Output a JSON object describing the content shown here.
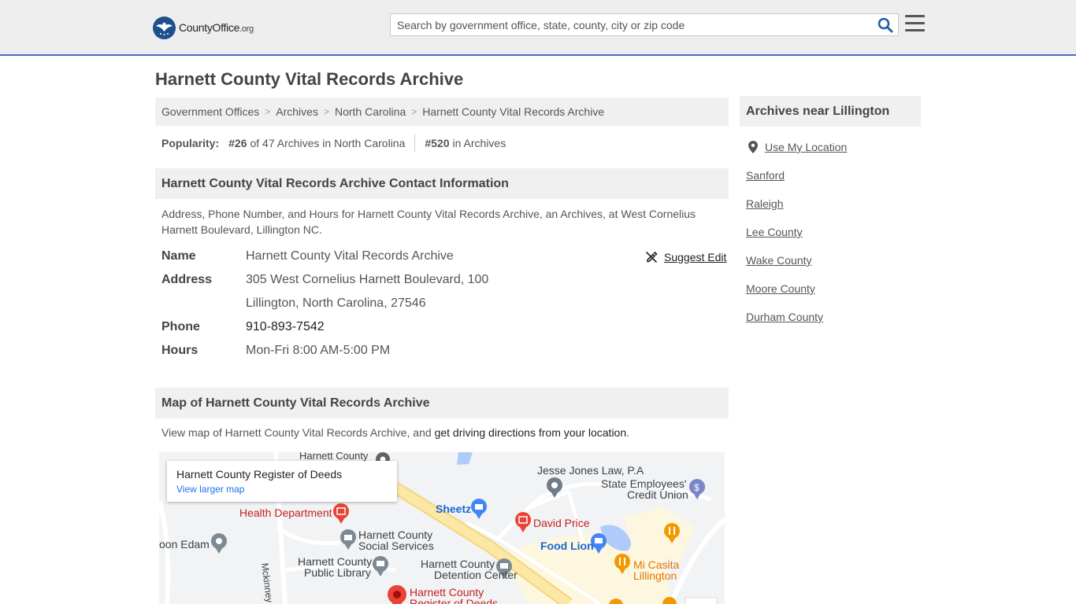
{
  "header": {
    "logo_text_main": "CountyOffice",
    "logo_text_org": ".org",
    "search_placeholder": "Search by government office, state, county, city or zip code",
    "search_icon": "search-icon",
    "menu_icon": "hamburger-menu-icon",
    "accent_color": "#3f74b8"
  },
  "page": {
    "title": "Harnett County Vital Records Archive"
  },
  "breadcrumb": [
    "Government Offices",
    "Archives",
    "North Carolina",
    "Harnett County Vital Records Archive"
  ],
  "popularity": {
    "label": "Popularity:",
    "state_rank": "#26",
    "state_text": "of 47 Archives in North Carolina",
    "national_rank": "#520",
    "national_text": "in Archives"
  },
  "contact": {
    "heading": "Harnett County Vital Records Archive Contact Information",
    "description": "Address, Phone Number, and Hours for Harnett County Vital Records Archive, an Archives, at West Cornelius Harnett Boulevard, Lillington NC.",
    "suggest_edit": "Suggest Edit",
    "name_label": "Name",
    "name_value": "Harnett County Vital Records Archive",
    "address_label": "Address",
    "address_line1": "305 West Cornelius Harnett Boulevard, 100",
    "address_line2": "Lillington, North Carolina, 27546",
    "phone_label": "Phone",
    "phone_value": "910-893-7542",
    "hours_label": "Hours",
    "hours_value": "Mon-Fri 8:00 AM-5:00 PM"
  },
  "map_section": {
    "heading": "Map of Harnett County Vital Records Archive",
    "intro": "View map of Harnett County Vital Records Archive, and",
    "directions_link": "get driving directions from your location",
    "intro_end": ".",
    "card_title": "Harnett County Register of Deeds",
    "card_link": "View larger map",
    "labels": {
      "harnett_county_top": "Harnett County",
      "jesse_jones": "Jesse Jones Law, P.A",
      "state_employees_1": "State Employees'",
      "state_employees_2": "Credit Union",
      "health_department": "Health Department",
      "sheetz": "Sheetz",
      "david_price": "David Price",
      "food_lion": "Food Lion",
      "mi_casita": "Mi Casita Lillington",
      "moon_edam": "oon Edam",
      "social_services_1": "Harnett County",
      "social_services_2": "Social Services",
      "library_1": "Harnett County",
      "library_2": "Public Library",
      "detention_1": "Harnett County",
      "detention_2": "Detention Center",
      "register_1": "Harnett County",
      "register_2": "Register of Deeds",
      "mckinney": "Mckinney Pk"
    }
  },
  "sidebar": {
    "heading": "Archives near Lillington",
    "use_location": "Use My Location",
    "links": [
      "Sanford",
      "Raleigh",
      "Lee County",
      "Wake County",
      "Moore County",
      "Durham County"
    ]
  }
}
